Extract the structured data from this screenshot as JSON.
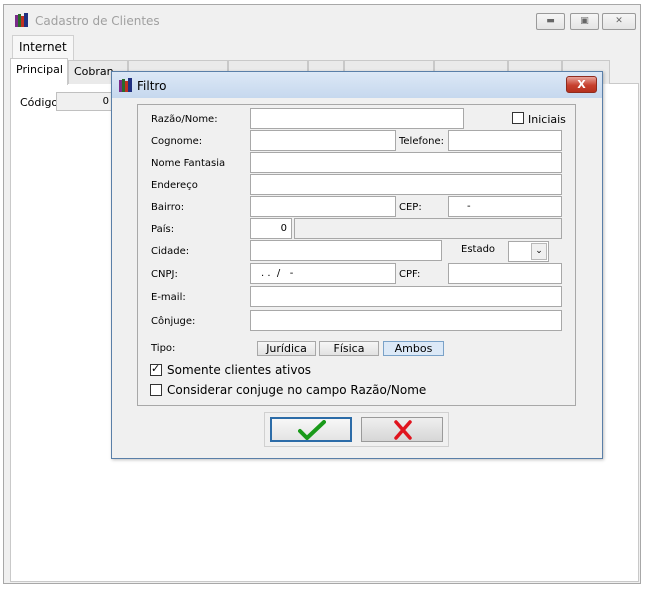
{
  "window": {
    "title": "Cadastro de Clientes",
    "menu_tab": "Internet",
    "tabs": [
      "Principal",
      "Cobran"
    ],
    "codigo_label": "Código",
    "codigo_value": "0"
  },
  "dialog": {
    "title": "Filtro",
    "close_glyph": "X",
    "fields": {
      "razao_label": "Razão/Nome:",
      "iniciais_label": "Iniciais",
      "cognome_label": "Cognome:",
      "telefone_label": "Telefone:",
      "fantasia_label": "Nome Fantasia",
      "endereco_label": "Endereço",
      "bairro_label": "Bairro:",
      "cep_label": "CEP:",
      "cep_value": "-",
      "pais_label": "País:",
      "pais_value": "0",
      "cidade_label": "Cidade:",
      "estado_label": "Estado",
      "cnpj_label": "CNPJ:",
      "cnpj_value": ". .  /   -",
      "cpf_label": "CPF:",
      "email_label": "E-mail:",
      "conjuge_label": "Cônjuge:",
      "tipo_label": "Tipo:"
    },
    "tipo_options": [
      "Jurídica",
      "Física",
      "Ambos"
    ],
    "tipo_selected": "Ambos",
    "checkboxes": {
      "somente_ativos": "Somente clientes ativos",
      "considerar_conjuge": "Considerar conjuge no campo Razão/Nome"
    },
    "checkbox_state": {
      "somente_ativos": true,
      "considerar_conjuge": false,
      "iniciais": false
    },
    "colors": {
      "ok_check": "#1a9a1a",
      "cancel_x": "#e0141e",
      "close_red": "#c7402e"
    }
  }
}
